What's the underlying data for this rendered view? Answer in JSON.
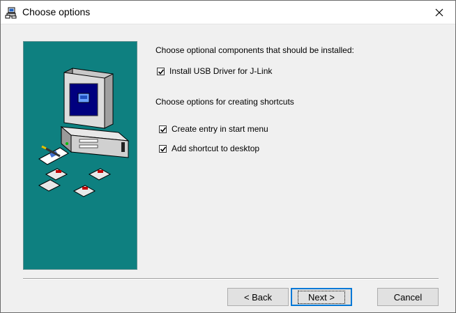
{
  "window": {
    "title": "Choose options",
    "close_glyph": "✕"
  },
  "main": {
    "components_heading": "Choose optional components that should be installed:",
    "usb_driver_label": "Install USB Driver for J-Link",
    "usb_driver_checked": true,
    "shortcuts_heading": "Choose options for creating shortcuts",
    "start_menu_label": "Create entry in start menu",
    "start_menu_checked": true,
    "desktop_label": "Add shortcut to desktop",
    "desktop_checked": true
  },
  "buttons": {
    "back": "< Back",
    "next": "Next >",
    "cancel": "Cancel"
  },
  "colors": {
    "panel_bg": "#0e8080",
    "accent_focus": "#0078d7"
  },
  "icons": {
    "title": "installer-icon",
    "illustration": "computer-with-floppy-disks"
  }
}
